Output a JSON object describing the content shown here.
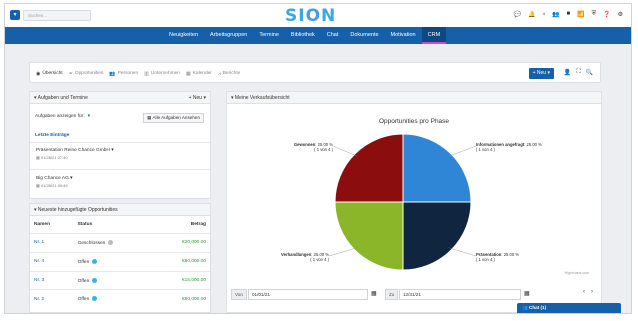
{
  "search": {
    "placeholder": "Suchen..."
  },
  "brand": {
    "logo_prefix": "SI",
    "logo_o": "O",
    "logo_suffix": "N"
  },
  "top_icons": [
    {
      "name": "chat-bubble-icon",
      "glyph": "💬"
    },
    {
      "name": "notification-bell-icon",
      "glyph": "🔔",
      "badge": "4"
    },
    {
      "name": "users-icon",
      "glyph": "👥"
    },
    {
      "name": "video-icon",
      "glyph": "■"
    },
    {
      "name": "broadcast-icon",
      "glyph": "📶"
    },
    {
      "name": "language-icon",
      "glyph": "⛨"
    },
    {
      "name": "help-icon",
      "glyph": "❓"
    },
    {
      "name": "settings-gear-icon",
      "glyph": "⚙"
    }
  ],
  "nav": {
    "items": [
      "Neuigkeiten",
      "Arbeitsgruppen",
      "Termine",
      "Bibliothek",
      "Chat",
      "Dokumente",
      "Motivation",
      "CRM"
    ],
    "active": "CRM"
  },
  "toolbar": {
    "tabs": [
      {
        "label": "Übersicht",
        "icon": "dashboard-icon"
      },
      {
        "label": "Opportunities",
        "icon": "handshake-icon"
      },
      {
        "label": "Personen",
        "icon": "persons-icon"
      },
      {
        "label": "Unternehmen",
        "icon": "building-icon"
      },
      {
        "label": "Kalender",
        "icon": "calendar-icon"
      },
      {
        "label": "Berichte",
        "icon": "report-chart-icon"
      }
    ],
    "new_label": "+ Neu ▾"
  },
  "tasks": {
    "title": "Aufgaben und Termine",
    "new_label": "Neu",
    "filter_label": "Aufgaben anzeigen für:",
    "filter_value": "▾",
    "all_button": "Alle Aufgaben Ansehen",
    "subheading": "Letzte Einträge",
    "items": [
      {
        "title": "Präsentation Reine Chance GmbH",
        "date": "01/28/21 07:40"
      },
      {
        "title": "Big Chance AG",
        "date": "01/28/21 09:49"
      }
    ]
  },
  "opportunities": {
    "title": "Neueste hinzugefügte Opportunities",
    "columns": [
      "Namen",
      "Status",
      "Betrag"
    ],
    "rows": [
      {
        "name": "Nr. 1",
        "status": "Geschlossen",
        "amount": "€20,000.00",
        "dot": "grey"
      },
      {
        "name": "Nr. 4",
        "status": "Offen",
        "amount": "€80,000.00",
        "dot": "blue"
      },
      {
        "name": "Nr. 3",
        "status": "Offen",
        "amount": "€15,000.00",
        "dot": "blue"
      },
      {
        "name": "Nr. 2",
        "status": "Offen",
        "amount": "€50,000.00",
        "dot": "blue"
      }
    ]
  },
  "overview": {
    "title": "Meine Verkaufsübersicht",
    "credit": "Highcharts.com",
    "from_label": "Von",
    "from_value": "01/01/21",
    "to_label": "Zu",
    "to_value": "12/31/21"
  },
  "chart_data": {
    "type": "pie",
    "title": "Opportunities pro Phase",
    "slices": [
      {
        "label": "Informationen angefragt",
        "value": 25.0,
        "count_text": "( 1 von 4 )",
        "color": "#2f86d6"
      },
      {
        "label": "Präsentation",
        "value": 25.0,
        "count_text": "( 1 von 4 )",
        "color": "#0f2540"
      },
      {
        "label": "Verhandlungen",
        "value": 25.0,
        "count_text": "( 1 von 4 )",
        "color": "#8bb62a"
      },
      {
        "label": "Gewonnen",
        "value": 25.0,
        "count_text": "( 1 von 4 )",
        "color": "#8c0d0d"
      }
    ],
    "value_suffix": "%"
  },
  "chat": {
    "label": "Chat (1)"
  }
}
